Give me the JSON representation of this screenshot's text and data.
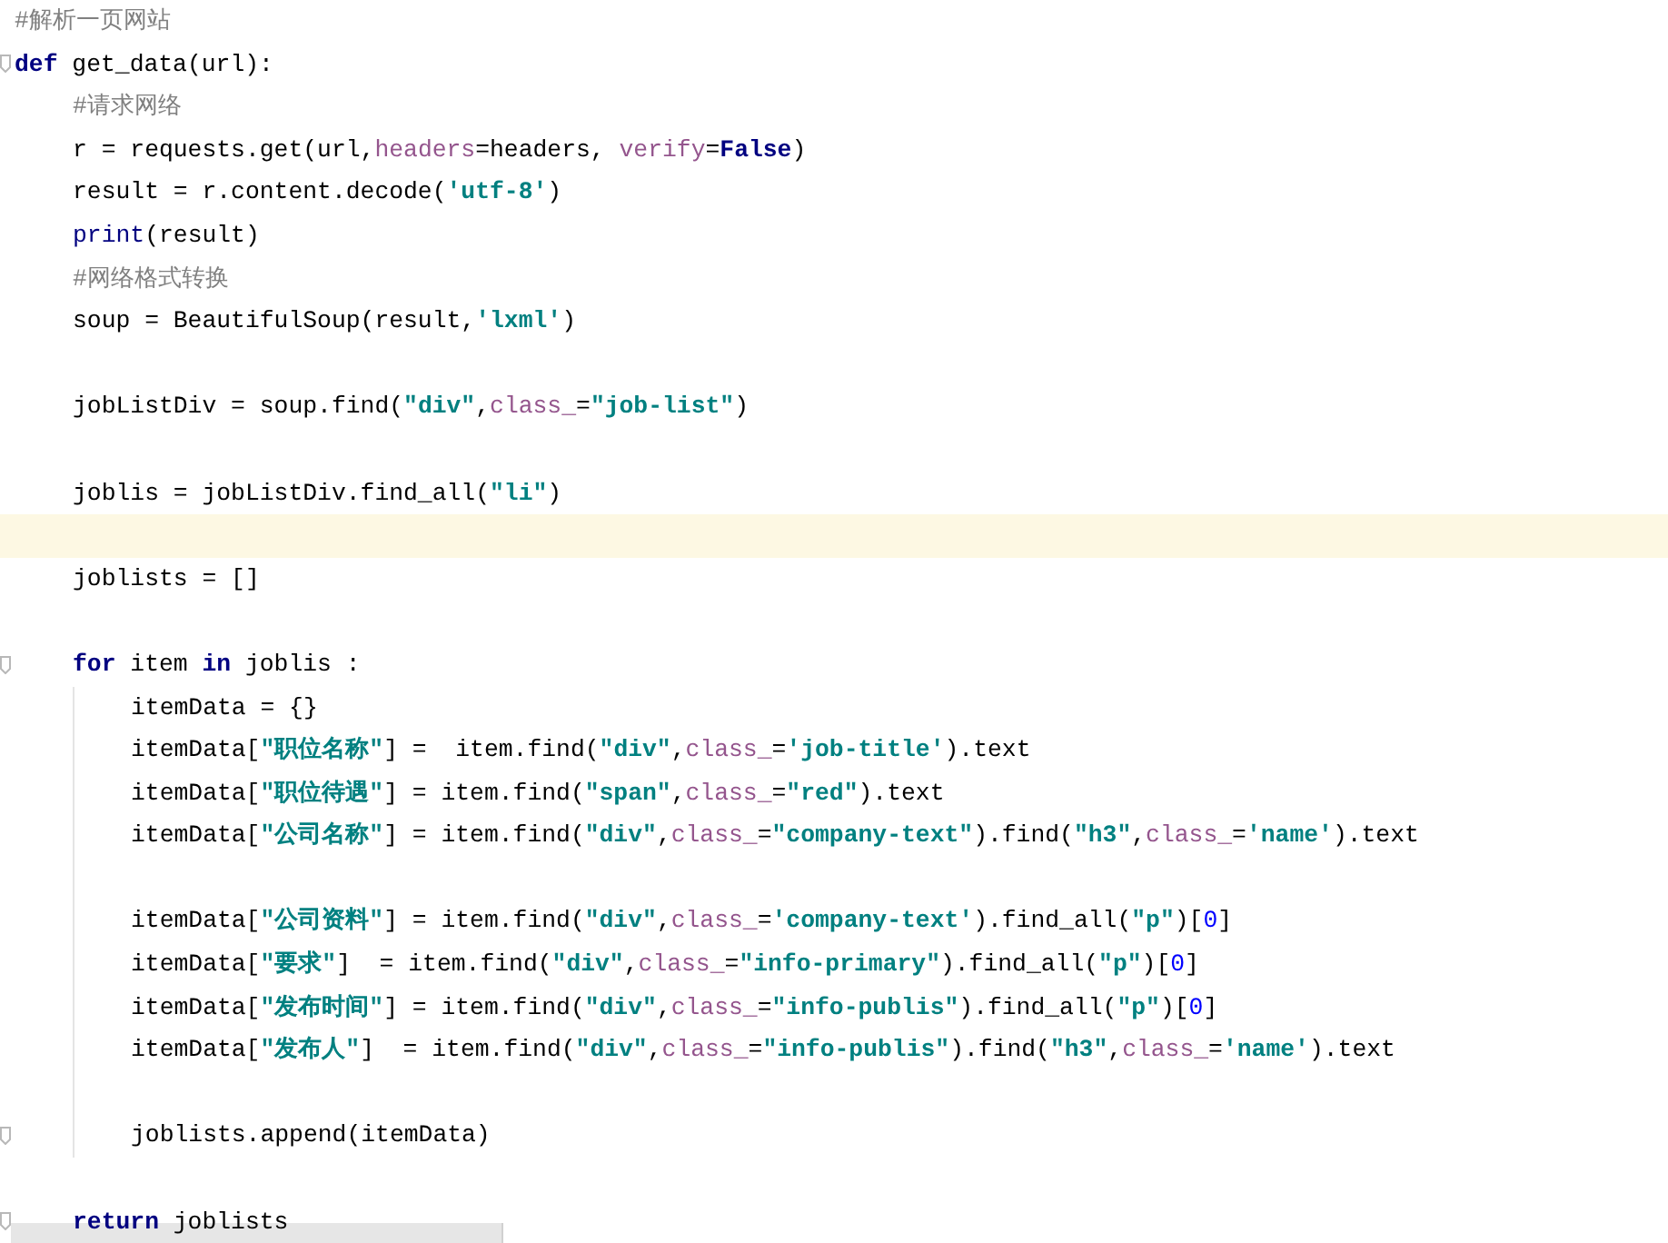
{
  "editor": {
    "lines": [
      {
        "kind": "code",
        "current": false,
        "fold": false,
        "tokens": [
          {
            "kind": "comment",
            "text": "#解析一页网站"
          }
        ]
      },
      {
        "kind": "code",
        "current": false,
        "fold": true,
        "tokens": [
          {
            "kind": "keyword",
            "text": "def"
          },
          {
            "kind": "plain",
            "text": " get_data(url):"
          }
        ],
        "children": [
          {
            "kind": "code",
            "current": false,
            "fold": false,
            "tokens": [
              {
                "kind": "comment",
                "text": "#请求网络"
              }
            ]
          },
          {
            "kind": "code",
            "current": false,
            "fold": false,
            "tokens": [
              {
                "kind": "plain",
                "text": "r = requests.get(url,"
              },
              {
                "kind": "param",
                "text": "headers"
              },
              {
                "kind": "plain",
                "text": "=headers, "
              },
              {
                "kind": "param",
                "text": "verify"
              },
              {
                "kind": "plain",
                "text": "="
              },
              {
                "kind": "keyword",
                "text": "False"
              },
              {
                "kind": "plain",
                "text": ")"
              }
            ]
          },
          {
            "kind": "code",
            "current": false,
            "fold": false,
            "tokens": [
              {
                "kind": "plain",
                "text": "result = r.content.decode("
              },
              {
                "kind": "string",
                "text": "'utf-8'"
              },
              {
                "kind": "plain",
                "text": ")"
              }
            ]
          },
          {
            "kind": "code",
            "current": false,
            "fold": false,
            "tokens": [
              {
                "kind": "builtin",
                "text": "print"
              },
              {
                "kind": "plain",
                "text": "(result)"
              }
            ]
          },
          {
            "kind": "code",
            "current": false,
            "fold": false,
            "tokens": [
              {
                "kind": "comment",
                "text": "#网络格式转换"
              }
            ]
          },
          {
            "kind": "code",
            "current": false,
            "fold": false,
            "tokens": [
              {
                "kind": "plain",
                "text": "soup = BeautifulSoup(result,"
              },
              {
                "kind": "string",
                "text": "'lxml'"
              },
              {
                "kind": "plain",
                "text": ")"
              }
            ]
          },
          {
            "kind": "blank",
            "current": false,
            "fold": false
          },
          {
            "kind": "code",
            "current": false,
            "fold": false,
            "tokens": [
              {
                "kind": "plain",
                "text": "jobListDiv = soup.find("
              },
              {
                "kind": "string",
                "text": "\"div\""
              },
              {
                "kind": "plain",
                "text": ","
              },
              {
                "kind": "param",
                "text": "class_"
              },
              {
                "kind": "plain",
                "text": "="
              },
              {
                "kind": "string",
                "text": "\"job-list\""
              },
              {
                "kind": "plain",
                "text": ")"
              }
            ]
          },
          {
            "kind": "blank",
            "current": false,
            "fold": false
          },
          {
            "kind": "code",
            "current": false,
            "fold": false,
            "tokens": [
              {
                "kind": "plain",
                "text": "joblis = jobListDiv.find_all("
              },
              {
                "kind": "string",
                "text": "\"li\""
              },
              {
                "kind": "plain",
                "text": ")"
              }
            ]
          },
          {
            "kind": "blank",
            "current": true,
            "fold": false
          },
          {
            "kind": "code",
            "current": false,
            "fold": false,
            "tokens": [
              {
                "kind": "plain",
                "text": "joblists = []"
              }
            ]
          },
          {
            "kind": "blank",
            "current": false,
            "fold": false
          },
          {
            "kind": "code",
            "current": false,
            "fold": true,
            "tokens": [
              {
                "kind": "keyword",
                "text": "for"
              },
              {
                "kind": "plain",
                "text": " item "
              },
              {
                "kind": "keyword",
                "text": "in"
              },
              {
                "kind": "plain",
                "text": " joblis :"
              }
            ],
            "children": [
              {
                "kind": "code",
                "current": false,
                "fold": false,
                "tokens": [
                  {
                    "kind": "plain",
                    "text": "itemData = {}"
                  }
                ]
              },
              {
                "kind": "code",
                "current": false,
                "fold": false,
                "tokens": [
                  {
                    "kind": "plain",
                    "text": "itemData["
                  },
                  {
                    "kind": "string",
                    "text": "\"职位名称\""
                  },
                  {
                    "kind": "plain",
                    "text": "] =  item.find("
                  },
                  {
                    "kind": "string",
                    "text": "\"div\""
                  },
                  {
                    "kind": "plain",
                    "text": ","
                  },
                  {
                    "kind": "param",
                    "text": "class_"
                  },
                  {
                    "kind": "plain",
                    "text": "="
                  },
                  {
                    "kind": "string",
                    "text": "'job-title'"
                  },
                  {
                    "kind": "plain",
                    "text": ").text"
                  }
                ]
              },
              {
                "kind": "code",
                "current": false,
                "fold": false,
                "tokens": [
                  {
                    "kind": "plain",
                    "text": "itemData["
                  },
                  {
                    "kind": "string",
                    "text": "\"职位待遇\""
                  },
                  {
                    "kind": "plain",
                    "text": "] = item.find("
                  },
                  {
                    "kind": "string",
                    "text": "\"span\""
                  },
                  {
                    "kind": "plain",
                    "text": ","
                  },
                  {
                    "kind": "param",
                    "text": "class_"
                  },
                  {
                    "kind": "plain",
                    "text": "="
                  },
                  {
                    "kind": "string",
                    "text": "\"red\""
                  },
                  {
                    "kind": "plain",
                    "text": ").text"
                  }
                ]
              },
              {
                "kind": "code",
                "current": false,
                "fold": false,
                "tokens": [
                  {
                    "kind": "plain",
                    "text": "itemData["
                  },
                  {
                    "kind": "string",
                    "text": "\"公司名称\""
                  },
                  {
                    "kind": "plain",
                    "text": "] = item.find("
                  },
                  {
                    "kind": "string",
                    "text": "\"div\""
                  },
                  {
                    "kind": "plain",
                    "text": ","
                  },
                  {
                    "kind": "param",
                    "text": "class_"
                  },
                  {
                    "kind": "plain",
                    "text": "="
                  },
                  {
                    "kind": "string",
                    "text": "\"company-text\""
                  },
                  {
                    "kind": "plain",
                    "text": ").find("
                  },
                  {
                    "kind": "string",
                    "text": "\"h3\""
                  },
                  {
                    "kind": "plain",
                    "text": ","
                  },
                  {
                    "kind": "param",
                    "text": "class_"
                  },
                  {
                    "kind": "plain",
                    "text": "="
                  },
                  {
                    "kind": "string",
                    "text": "'name'"
                  },
                  {
                    "kind": "plain",
                    "text": ").text"
                  }
                ]
              },
              {
                "kind": "blank",
                "current": false,
                "fold": false
              },
              {
                "kind": "code",
                "current": false,
                "fold": false,
                "tokens": [
                  {
                    "kind": "plain",
                    "text": "itemData["
                  },
                  {
                    "kind": "string",
                    "text": "\"公司资料\""
                  },
                  {
                    "kind": "plain",
                    "text": "] = item.find("
                  },
                  {
                    "kind": "string",
                    "text": "\"div\""
                  },
                  {
                    "kind": "plain",
                    "text": ","
                  },
                  {
                    "kind": "param",
                    "text": "class_"
                  },
                  {
                    "kind": "plain",
                    "text": "="
                  },
                  {
                    "kind": "string",
                    "text": "'company-text'"
                  },
                  {
                    "kind": "plain",
                    "text": ").find_all("
                  },
                  {
                    "kind": "string",
                    "text": "\"p\""
                  },
                  {
                    "kind": "plain",
                    "text": ")["
                  },
                  {
                    "kind": "number",
                    "text": "0"
                  },
                  {
                    "kind": "plain",
                    "text": "]"
                  }
                ]
              },
              {
                "kind": "code",
                "current": false,
                "fold": false,
                "tokens": [
                  {
                    "kind": "plain",
                    "text": "itemData["
                  },
                  {
                    "kind": "string",
                    "text": "\"要求\""
                  },
                  {
                    "kind": "plain",
                    "text": "]  = item.find("
                  },
                  {
                    "kind": "string",
                    "text": "\"div\""
                  },
                  {
                    "kind": "plain",
                    "text": ","
                  },
                  {
                    "kind": "param",
                    "text": "class_"
                  },
                  {
                    "kind": "plain",
                    "text": "="
                  },
                  {
                    "kind": "string",
                    "text": "\"info-primary\""
                  },
                  {
                    "kind": "plain",
                    "text": ").find_all("
                  },
                  {
                    "kind": "string",
                    "text": "\"p\""
                  },
                  {
                    "kind": "plain",
                    "text": ")["
                  },
                  {
                    "kind": "number",
                    "text": "0"
                  },
                  {
                    "kind": "plain",
                    "text": "]"
                  }
                ]
              },
              {
                "kind": "code",
                "current": false,
                "fold": false,
                "tokens": [
                  {
                    "kind": "plain",
                    "text": "itemData["
                  },
                  {
                    "kind": "string",
                    "text": "\"发布时间\""
                  },
                  {
                    "kind": "plain",
                    "text": "] = item.find("
                  },
                  {
                    "kind": "string",
                    "text": "\"div\""
                  },
                  {
                    "kind": "plain",
                    "text": ","
                  },
                  {
                    "kind": "param",
                    "text": "class_"
                  },
                  {
                    "kind": "plain",
                    "text": "="
                  },
                  {
                    "kind": "string",
                    "text": "\"info-publis\""
                  },
                  {
                    "kind": "plain",
                    "text": ").find_all("
                  },
                  {
                    "kind": "string",
                    "text": "\"p\""
                  },
                  {
                    "kind": "plain",
                    "text": ")["
                  },
                  {
                    "kind": "number",
                    "text": "0"
                  },
                  {
                    "kind": "plain",
                    "text": "]"
                  }
                ]
              },
              {
                "kind": "code",
                "current": false,
                "fold": false,
                "tokens": [
                  {
                    "kind": "plain",
                    "text": "itemData["
                  },
                  {
                    "kind": "string",
                    "text": "\"发布人\""
                  },
                  {
                    "kind": "plain",
                    "text": "]  = item.find("
                  },
                  {
                    "kind": "string",
                    "text": "\"div\""
                  },
                  {
                    "kind": "plain",
                    "text": ","
                  },
                  {
                    "kind": "param",
                    "text": "class_"
                  },
                  {
                    "kind": "plain",
                    "text": "="
                  },
                  {
                    "kind": "string",
                    "text": "\"info-publis\""
                  },
                  {
                    "kind": "plain",
                    "text": ").find("
                  },
                  {
                    "kind": "string",
                    "text": "\"h3\""
                  },
                  {
                    "kind": "plain",
                    "text": ","
                  },
                  {
                    "kind": "param",
                    "text": "class_"
                  },
                  {
                    "kind": "plain",
                    "text": "="
                  },
                  {
                    "kind": "string",
                    "text": "'name'"
                  },
                  {
                    "kind": "plain",
                    "text": ").text"
                  }
                ]
              },
              {
                "kind": "blank",
                "current": false,
                "fold": false
              },
              {
                "kind": "code",
                "current": false,
                "fold": true,
                "tokens": [
                  {
                    "kind": "plain",
                    "text": "joblists.append(itemData)"
                  }
                ]
              }
            ]
          },
          {
            "kind": "blank",
            "current": false,
            "fold": false
          },
          {
            "kind": "code",
            "current": false,
            "fold": true,
            "tokens": [
              {
                "kind": "keyword",
                "text": "return"
              },
              {
                "kind": "plain",
                "text": " joblists"
              }
            ]
          }
        ]
      }
    ]
  }
}
